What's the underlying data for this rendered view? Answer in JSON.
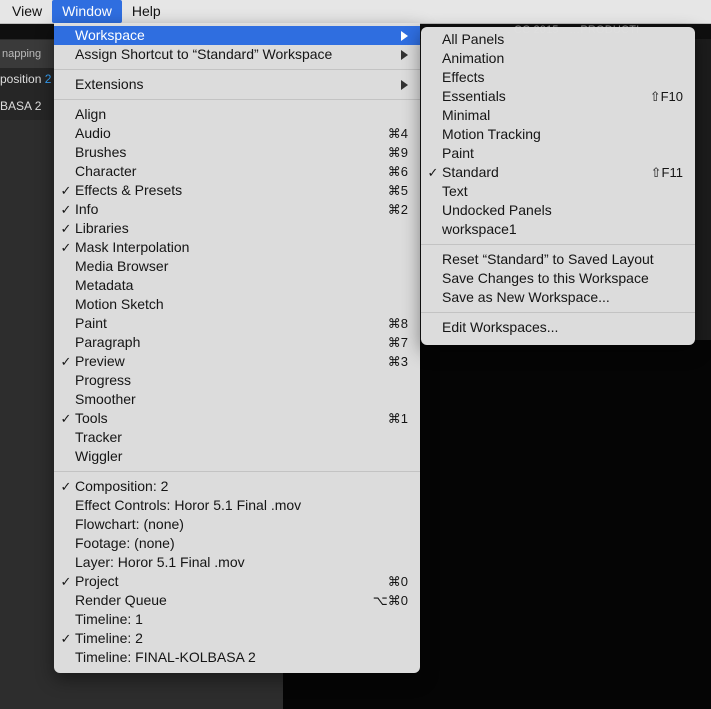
{
  "menubar": {
    "items": [
      {
        "label": "View"
      },
      {
        "label": "Window"
      },
      {
        "label": "Help"
      }
    ]
  },
  "background": {
    "toolbar_text": "napping",
    "tab1_text": "position",
    "tab1_num": "2",
    "tab2_text": "BASA 2",
    "title_text": "… .  … .  CC 2015  · …PRODUCTI"
  },
  "window_menu": {
    "items": [
      {
        "type": "item",
        "label": "Workspace",
        "submenu": true,
        "highlighted": true
      },
      {
        "type": "item",
        "label": "Assign Shortcut to “Standard” Workspace",
        "submenu": true
      },
      {
        "type": "sep"
      },
      {
        "type": "item",
        "label": "Extensions",
        "submenu": true
      },
      {
        "type": "sep"
      },
      {
        "type": "item",
        "label": "Align"
      },
      {
        "type": "item",
        "label": "Audio",
        "shortcut": "⌘4"
      },
      {
        "type": "item",
        "label": "Brushes",
        "shortcut": "⌘9"
      },
      {
        "type": "item",
        "label": "Character",
        "shortcut": "⌘6"
      },
      {
        "type": "item",
        "label": "Effects & Presets",
        "shortcut": "⌘5",
        "checked": true
      },
      {
        "type": "item",
        "label": "Info",
        "shortcut": "⌘2",
        "checked": true
      },
      {
        "type": "item",
        "label": "Libraries",
        "checked": true
      },
      {
        "type": "item",
        "label": "Mask Interpolation",
        "checked": true
      },
      {
        "type": "item",
        "label": "Media Browser"
      },
      {
        "type": "item",
        "label": "Metadata"
      },
      {
        "type": "item",
        "label": "Motion Sketch"
      },
      {
        "type": "item",
        "label": "Paint",
        "shortcut": "⌘8"
      },
      {
        "type": "item",
        "label": "Paragraph",
        "shortcut": "⌘7"
      },
      {
        "type": "item",
        "label": "Preview",
        "shortcut": "⌘3",
        "checked": true
      },
      {
        "type": "item",
        "label": "Progress"
      },
      {
        "type": "item",
        "label": "Smoother"
      },
      {
        "type": "item",
        "label": "Tools",
        "shortcut": "⌘1",
        "checked": true
      },
      {
        "type": "item",
        "label": "Tracker"
      },
      {
        "type": "item",
        "label": "Wiggler"
      },
      {
        "type": "sep"
      },
      {
        "type": "item",
        "label": "Composition: 2",
        "checked": true
      },
      {
        "type": "item",
        "label": "Effect Controls: Horor 5.1 Final .mov"
      },
      {
        "type": "item",
        "label": "Flowchart: (none)"
      },
      {
        "type": "item",
        "label": "Footage: (none)"
      },
      {
        "type": "item",
        "label": "Layer: Horor 5.1 Final .mov"
      },
      {
        "type": "item",
        "label": "Project",
        "shortcut": "⌘0",
        "checked": true
      },
      {
        "type": "item",
        "label": "Render Queue",
        "shortcut": "⌥⌘0"
      },
      {
        "type": "item",
        "label": "Timeline: 1"
      },
      {
        "type": "item",
        "label": "Timeline: 2",
        "checked": true
      },
      {
        "type": "item",
        "label": "Timeline: FINAL-KOLBASA 2"
      }
    ]
  },
  "workspace_submenu": {
    "items": [
      {
        "type": "item",
        "label": "All Panels"
      },
      {
        "type": "item",
        "label": "Animation"
      },
      {
        "type": "item",
        "label": "Effects"
      },
      {
        "type": "item",
        "label": "Essentials",
        "shortcut": "⇧F10"
      },
      {
        "type": "item",
        "label": "Minimal"
      },
      {
        "type": "item",
        "label": "Motion Tracking"
      },
      {
        "type": "item",
        "label": "Paint"
      },
      {
        "type": "item",
        "label": "Standard",
        "shortcut": "⇧F11",
        "checked": true
      },
      {
        "type": "item",
        "label": "Text"
      },
      {
        "type": "item",
        "label": "Undocked Panels"
      },
      {
        "type": "item",
        "label": "workspace1"
      },
      {
        "type": "sep"
      },
      {
        "type": "item",
        "label": "Reset “Standard” to Saved Layout"
      },
      {
        "type": "item",
        "label": "Save Changes to this Workspace"
      },
      {
        "type": "item",
        "label": "Save as New Workspace..."
      },
      {
        "type": "sep"
      },
      {
        "type": "item",
        "label": "Edit Workspaces..."
      }
    ]
  },
  "colors": {
    "highlight": "#2f6ee0",
    "menu_bg": "#e0e0e0"
  },
  "icons": {
    "check": "checkmark-icon",
    "submenu": "chevron-right-icon"
  }
}
